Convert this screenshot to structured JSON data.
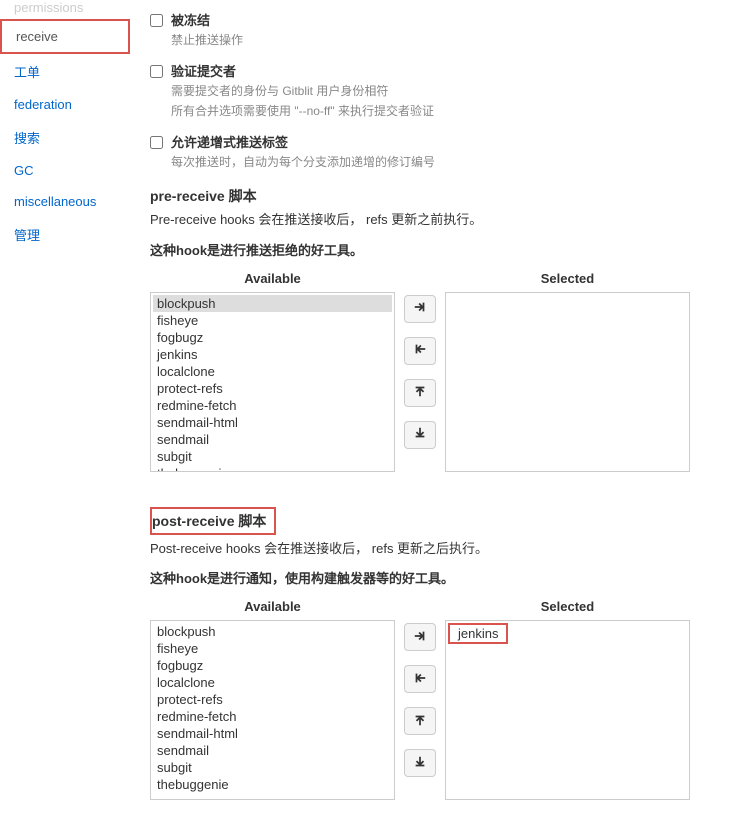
{
  "sidebar": {
    "items": [
      {
        "label": "permissions"
      },
      {
        "label": "receive"
      },
      {
        "label": "工单"
      },
      {
        "label": "federation"
      },
      {
        "label": "搜索"
      },
      {
        "label": "GC"
      },
      {
        "label": "miscellaneous"
      },
      {
        "label": "管理"
      }
    ]
  },
  "checkboxes": {
    "frozen": {
      "label": "被冻结",
      "desc": "禁止推送操作"
    },
    "verify": {
      "label": "验证提交者",
      "desc1": "需要提交者的身份与 Gitblit 用户身份相符",
      "desc2": "所有合并选项需要使用 \"--no-ff\" 来执行提交者验证"
    },
    "incremental": {
      "label": "允许递增式推送标签",
      "desc": "每次推送时，自动为每个分支添加递增的修订编号"
    }
  },
  "pre": {
    "title": "pre-receive 脚本",
    "desc": "Pre-receive hooks 会在推送接收后， refs 更新之前执行。",
    "note": "这种hook是进行推送拒绝的好工具。",
    "available_header": "Available",
    "selected_header": "Selected",
    "available": [
      "blockpush",
      "fisheye",
      "fogbugz",
      "jenkins",
      "localclone",
      "protect-refs",
      "redmine-fetch",
      "sendmail-html",
      "sendmail",
      "subgit",
      "thebuggenie"
    ],
    "selected": []
  },
  "post": {
    "title": "post-receive 脚本",
    "desc": "Post-receive hooks 会在推送接收后， refs 更新之后执行。",
    "note": "这种hook是进行通知，使用构建触发器等的好工具。",
    "available_header": "Available",
    "selected_header": "Selected",
    "available": [
      "blockpush",
      "fisheye",
      "fogbugz",
      "localclone",
      "protect-refs",
      "redmine-fetch",
      "sendmail-html",
      "sendmail",
      "subgit",
      "thebuggenie"
    ],
    "selected": [
      "jenkins"
    ]
  }
}
